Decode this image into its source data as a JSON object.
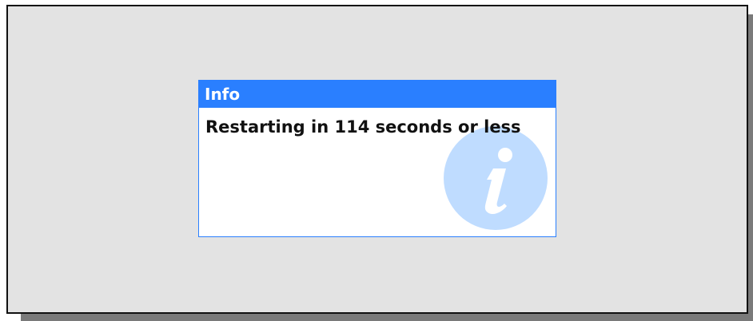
{
  "dialog": {
    "title": "Info",
    "message": "Restarting in 114 seconds or less",
    "icon": "info-icon"
  },
  "colors": {
    "accent": "#2a7fff",
    "background": "#e3e3e3",
    "watermark": "#bfdcff"
  }
}
